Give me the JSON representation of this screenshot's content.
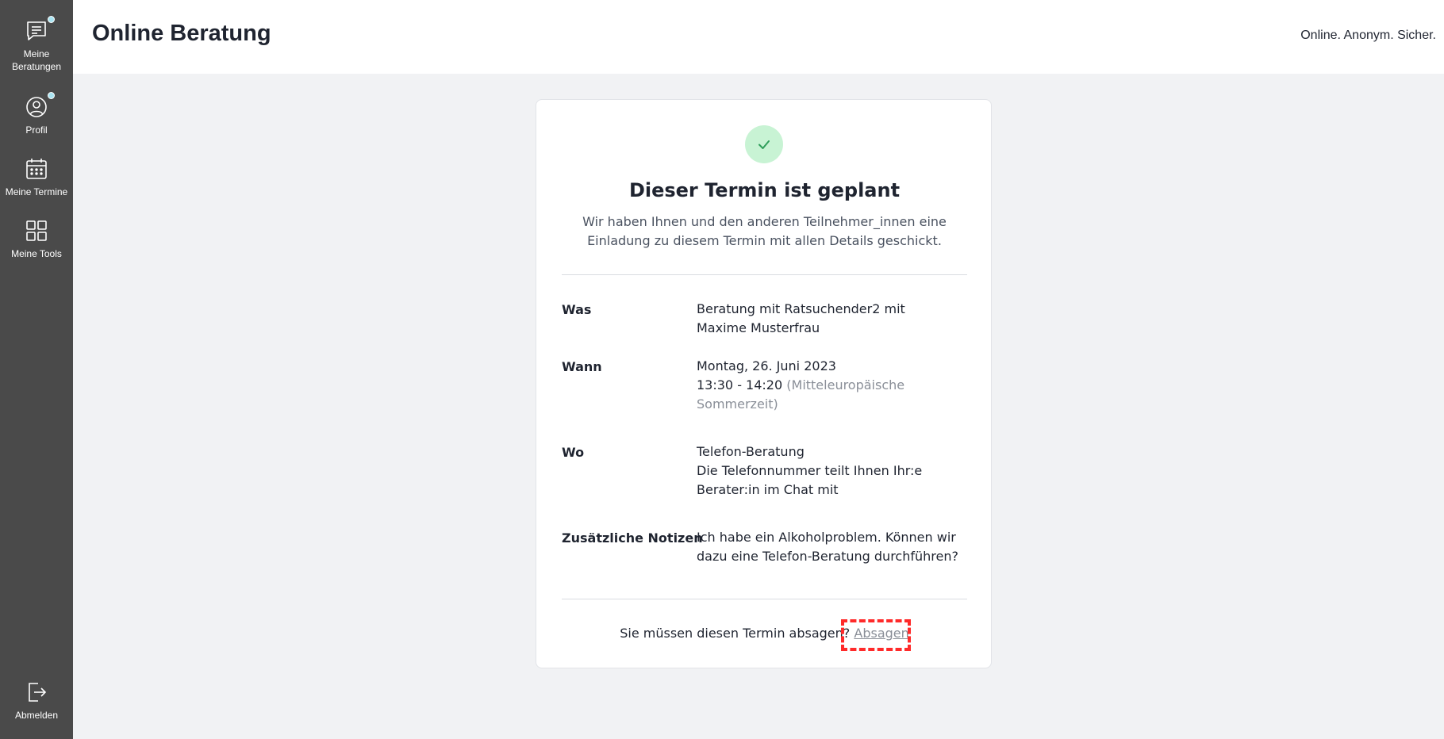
{
  "sidebar": {
    "items": [
      {
        "label": "Meine\nBeratungen",
        "icon": "chat-icon",
        "has_dot": true
      },
      {
        "label": "Profil",
        "icon": "user-circle-icon",
        "has_dot": true
      },
      {
        "label": "Meine Termine",
        "icon": "calendar-icon",
        "has_dot": false
      },
      {
        "label": "Meine Tools",
        "icon": "grid-icon",
        "has_dot": false
      }
    ],
    "logout_label": "Abmelden"
  },
  "header": {
    "title": "Online Beratung",
    "tagline": "Online. Anonym. Sicher."
  },
  "appointment": {
    "status_title": "Dieser Termin ist geplant",
    "status_subtitle": "Wir haben Ihnen und den anderen Teilnehmer_innen eine Einladung zu diesem Termin mit allen Details geschickt.",
    "details": {
      "what_label": "Was",
      "what_value": "Beratung mit Ratsuchender2 mit Maxime Musterfrau",
      "when_label": "Wann",
      "when_date": "Montag, 26. Juni 2023",
      "when_time": "13:30 - 14:20",
      "when_timezone": "(Mitteleuropäische Sommerzeit)",
      "where_label": "Wo",
      "where_value": "Telefon-Beratung",
      "where_note": "Die Telefonnummer teilt Ihnen Ihr:e Berater:in im Chat mit",
      "notes_label": "Zusätzliche Notizen",
      "notes_value": "Ich habe ein Alkoholproblem. Können wir dazu eine Telefon-Beratung durchführen?"
    },
    "cancel_question": "Sie müssen diesen Termin absagen?",
    "cancel_link": "Absagen"
  },
  "colors": {
    "sidebar_bg": "#4a4a4a",
    "check_bg": "#c8f3d4",
    "check_color": "#2f9e5a",
    "highlight": "#ff2a2a",
    "notification_dot": "#a9e4f2"
  }
}
